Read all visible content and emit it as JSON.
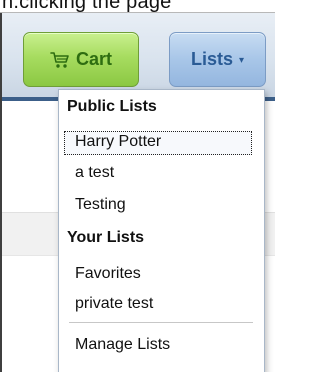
{
  "page": {
    "top_text": "n.clicking the page"
  },
  "header": {
    "cart_label": "Cart",
    "lists_label": "Lists",
    "lists_caret": "▾"
  },
  "icons": {
    "cart_icon": "shopping-cart-icon",
    "dropdown_arrow": "chevron-down-icon"
  },
  "dropdown": {
    "public_heading": "Public Lists",
    "public_items": [
      "Harry Potter",
      "a test",
      "Testing"
    ],
    "your_heading": "Your Lists",
    "your_items": [
      "Favorites",
      "private test"
    ],
    "manage_label": "Manage Lists"
  },
  "colors": {
    "cart_text": "#2e6d11",
    "lists_text": "#2a5b95",
    "header_bottom": "#3c5f89"
  }
}
